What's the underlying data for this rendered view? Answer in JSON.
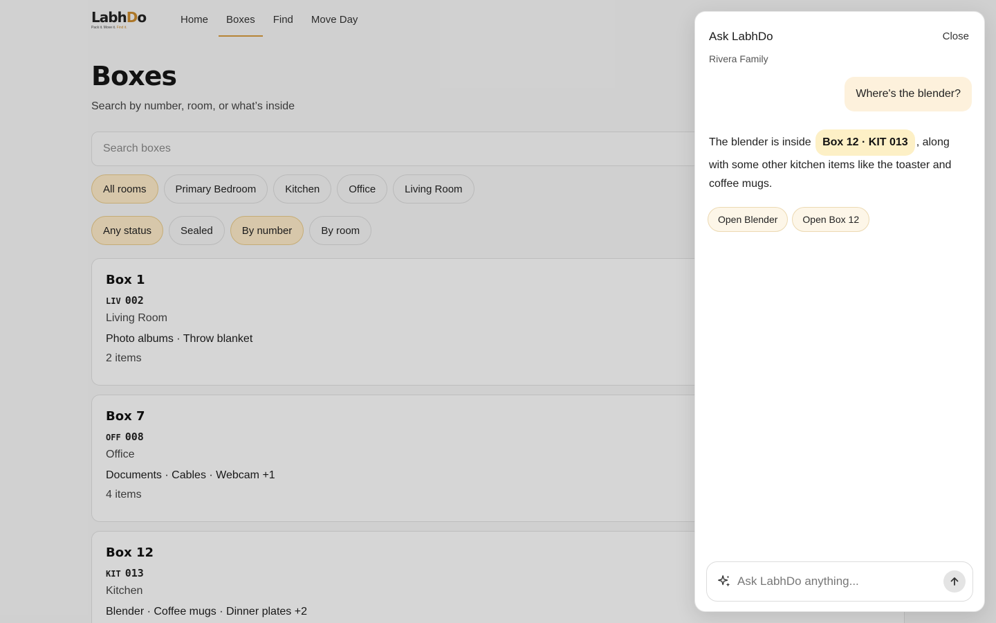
{
  "brand": {
    "logo_word": "LabhDo",
    "logo_tagline": "Pack it. Move it. Find it."
  },
  "nav": {
    "items": [
      {
        "label": "Home",
        "active": false
      },
      {
        "label": "Boxes",
        "active": true
      },
      {
        "label": "Find",
        "active": false
      },
      {
        "label": "Move Day",
        "active": false
      }
    ]
  },
  "page": {
    "title": "Boxes",
    "subtitle": "Search by number, room, or what’s inside",
    "search_placeholder": "Search boxes"
  },
  "room_filters": [
    {
      "label": "All rooms",
      "selected": true
    },
    {
      "label": "Primary Bedroom",
      "selected": false
    },
    {
      "label": "Kitchen",
      "selected": false
    },
    {
      "label": "Office",
      "selected": false
    },
    {
      "label": "Living Room",
      "selected": false
    }
  ],
  "status_filters": [
    {
      "label": "Any status",
      "selected": true
    },
    {
      "label": "Sealed",
      "selected": false
    },
    {
      "label": "By number",
      "selected": true
    },
    {
      "label": "By room",
      "selected": false
    }
  ],
  "boxes": [
    {
      "title": "Box 1",
      "code_prefix": "LIV",
      "code_num": "002",
      "room": "Living Room",
      "contents": "Photo albums · Throw blanket",
      "count": "2 items"
    },
    {
      "title": "Box 7",
      "code_prefix": "OFF",
      "code_num": "008",
      "room": "Office",
      "contents": "Documents · Cables · Webcam +1",
      "count": "4 items"
    },
    {
      "title": "Box 12",
      "code_prefix": "KIT",
      "code_num": "013",
      "room": "Kitchen",
      "contents": "Blender · Coffee mugs · Dinner plates +2",
      "count": ""
    }
  ],
  "chat": {
    "title": "Ask LabhDo",
    "close_label": "Close",
    "household": "Rivera Family",
    "user_message": "Where's the blender?",
    "reply_before": "The blender is inside",
    "reply_box_ref": "Box 12 · KIT 013",
    "reply_after": ", along with some other kitchen items like the toaster and coffee mugs.",
    "actions": [
      "Open Blender",
      "Open Box 12"
    ],
    "input_placeholder": "Ask LabhDo anything..."
  },
  "colors": {
    "accent": "#d49a3e",
    "chip_selected_bg": "#fbe8c6",
    "user_bubble_bg": "#fdf1dc",
    "box_pill_bg": "#fdf0c6"
  }
}
